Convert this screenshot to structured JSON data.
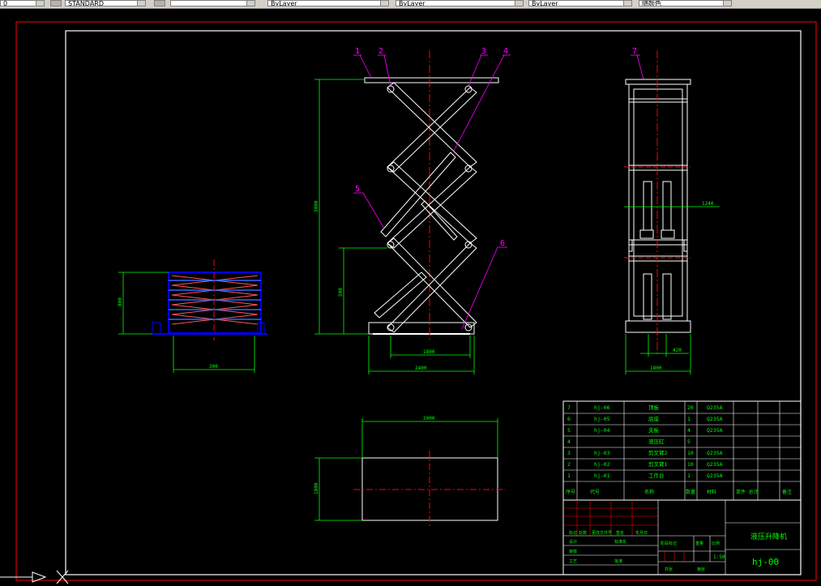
{
  "toolbar": {
    "fields": [
      {
        "name": "layer-select",
        "value": "0"
      },
      {
        "name": "textstyle-select",
        "value": "STANDARD"
      },
      {
        "name": "color-select",
        "value": "ByLayer"
      },
      {
        "name": "linetype-select",
        "value": "ByLayer"
      },
      {
        "name": "lineweight-select",
        "value": "ByLayer"
      },
      {
        "name": "plotstyle-select",
        "value": "随颜色"
      }
    ]
  },
  "drawing": {
    "part_labels": [
      "1",
      "2",
      "3",
      "4",
      "5",
      "6",
      "7"
    ],
    "dimensions": {
      "front_height": "3000",
      "front_mid": "500",
      "front_base_inner": "1800",
      "front_base_outer": "2400",
      "side_width": "1800",
      "side_inner": "420",
      "side_mid": "1240",
      "small_width": "300",
      "small_height": "800",
      "plan_width": "2000",
      "plan_height": "1800"
    }
  },
  "bom": {
    "rows": [
      {
        "no": "7",
        "code": "hj-06",
        "name": "顶板",
        "qty": "20",
        "mat": "Q235A"
      },
      {
        "no": "6",
        "code": "hj-05",
        "name": "底座",
        "qty": "1",
        "mat": "Q235A"
      },
      {
        "no": "5",
        "code": "hj-04",
        "name": "支板",
        "qty": "4",
        "mat": "Q235A"
      },
      {
        "no": "4",
        "code": "",
        "name": "液压缸",
        "qty": "5",
        "mat": ""
      },
      {
        "no": "3",
        "code": "hj-03",
        "name": "剪叉臂2",
        "qty": "10",
        "mat": "Q235A"
      },
      {
        "no": "2",
        "code": "hj-02",
        "name": "剪叉臂1",
        "qty": "10",
        "mat": "Q235A"
      },
      {
        "no": "1",
        "code": "hj-01",
        "name": "工作台",
        "qty": "1",
        "mat": "Q235A"
      }
    ],
    "header": {
      "no": "序号",
      "code": "代号",
      "name": "名称",
      "qty": "数量",
      "mat": "材料",
      "weight": "单件 总计",
      "note": "备注"
    }
  },
  "title_block": {
    "title": "液压升降机",
    "drawing_no": "hj-00",
    "scale": "1:50",
    "labels": [
      "标记",
      "处数",
      "分区",
      "更改文件号",
      "签名",
      "年月日",
      "设计",
      "标准化",
      "审核",
      "工艺",
      "批准",
      "阶段标记",
      "重量",
      "比例",
      "共张",
      "第张"
    ]
  },
  "colors": {
    "frame_red": "#ff0000",
    "white": "#ffffff",
    "green": "#00ff00",
    "magenta": "#ff00ff",
    "blue": "#0000ff",
    "yellow": "#ffff00"
  }
}
